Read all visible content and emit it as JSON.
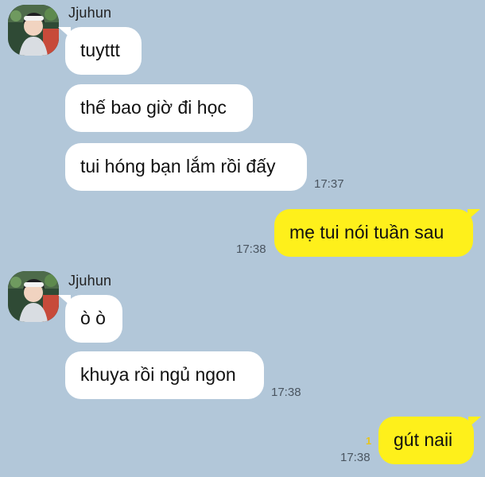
{
  "theme": {
    "background": "#b2c7d9",
    "incoming_bubble": "#ffffff",
    "outgoing_bubble": "#fef01b",
    "unread_color": "#e8c51a"
  },
  "messages": {
    "group1": {
      "sender": "Jjuhun",
      "avatar_icon": "profile-avatar-icon",
      "bubbles": [
        "tuyttt",
        "thế bao giờ đi học",
        "tui hóng bạn lắm rồi đấy"
      ],
      "time": "17:37"
    },
    "out1": {
      "text": "mẹ tui nói tuần sau",
      "time": "17:38"
    },
    "group2": {
      "sender": "Jjuhun",
      "avatar_icon": "profile-avatar-icon",
      "bubbles": [
        "ò ò",
        "khuya rồi ngủ ngon"
      ],
      "time": "17:38"
    },
    "out2": {
      "text": "gút naii",
      "unread": "1",
      "time": "17:38"
    }
  }
}
